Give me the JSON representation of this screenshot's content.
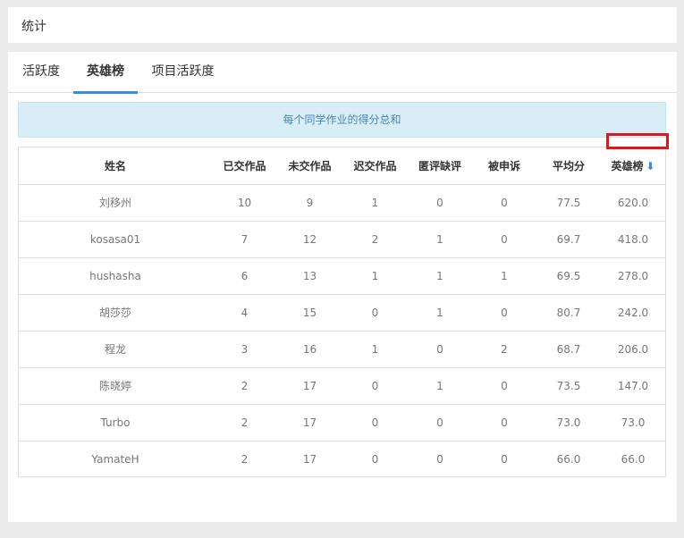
{
  "header": {
    "title": "统计"
  },
  "tabs": [
    {
      "label": "活跃度",
      "active": false
    },
    {
      "label": "英雄榜",
      "active": true
    },
    {
      "label": "项目活跃度",
      "active": false
    }
  ],
  "info": {
    "text": "每个同学作业的得分总和"
  },
  "table": {
    "columns": [
      "姓名",
      "已交作品",
      "未交作品",
      "迟交作品",
      "匿评缺评",
      "被申诉",
      "平均分",
      "英雄榜"
    ],
    "sort_icon": "arrow-down-icon",
    "rows": [
      [
        "刘移州",
        "10",
        "9",
        "1",
        "0",
        "0",
        "77.5",
        "620.0"
      ],
      [
        "kosasa01",
        "7",
        "12",
        "2",
        "1",
        "0",
        "69.7",
        "418.0"
      ],
      [
        "hushasha",
        "6",
        "13",
        "1",
        "1",
        "1",
        "69.5",
        "278.0"
      ],
      [
        "胡莎莎",
        "4",
        "15",
        "0",
        "1",
        "0",
        "80.7",
        "242.0"
      ],
      [
        "程龙",
        "3",
        "16",
        "1",
        "0",
        "2",
        "68.7",
        "206.0"
      ],
      [
        "陈晓婷",
        "2",
        "17",
        "0",
        "1",
        "0",
        "73.5",
        "147.0"
      ],
      [
        "Turbo",
        "2",
        "17",
        "0",
        "0",
        "0",
        "73.0",
        "73.0"
      ],
      [
        "YamateH",
        "2",
        "17",
        "0",
        "0",
        "0",
        "66.0",
        "66.0"
      ]
    ]
  },
  "colors": {
    "accent": "#3a8fd6",
    "info_bg": "#d9edf7",
    "highlight": "#d9191b"
  }
}
